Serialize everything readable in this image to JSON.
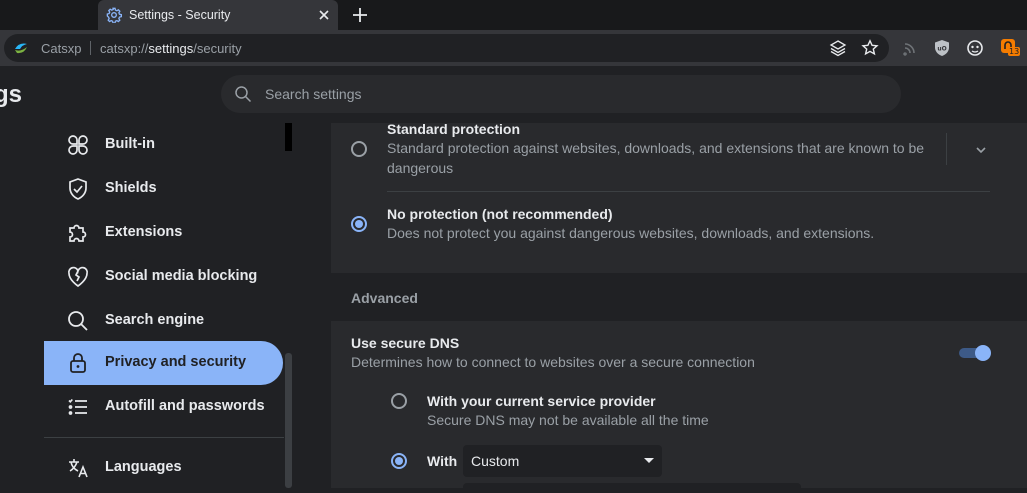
{
  "browser": {
    "tab_title": "Settings - Security",
    "brand": "Catsxp",
    "url_scheme": "catsxp://",
    "url_host": "settings",
    "url_path": "/security",
    "badge_count": "13"
  },
  "header": {
    "title": "Settings",
    "search_placeholder": "Search settings"
  },
  "sidebar": {
    "items": [
      {
        "label": "Built-in",
        "icon": "built-in-icon"
      },
      {
        "label": "Shields",
        "icon": "shield-icon"
      },
      {
        "label": "Extensions",
        "icon": "puzzle-icon"
      },
      {
        "label": "Social media blocking",
        "icon": "heart-broken-icon"
      },
      {
        "label": "Search engine",
        "icon": "search-icon"
      },
      {
        "label": "Privacy and security",
        "icon": "lock-icon",
        "active": true
      },
      {
        "label": "Autofill and passwords",
        "icon": "list-icon"
      },
      {
        "label": "Languages",
        "icon": "translate-icon"
      }
    ]
  },
  "main": {
    "standard": {
      "title": "Standard protection",
      "desc": "Standard protection against websites, downloads, and extensions that are known to be dangerous"
    },
    "none": {
      "title": "No protection (not recommended)",
      "desc": "Does not protect you against dangerous websites, downloads, and extensions."
    },
    "advanced_label": "Advanced",
    "secure_dns": {
      "title": "Use secure DNS",
      "desc": "Determines how to connect to websites over a secure connection",
      "enabled": true
    },
    "provider_current": {
      "title": "With your current service provider",
      "desc": "Secure DNS may not be available all the time"
    },
    "provider_custom": {
      "label": "With",
      "selected": "Custom"
    }
  },
  "colors": {
    "accent": "#8ab4f8",
    "background": "#202124",
    "card": "#292a2d"
  }
}
